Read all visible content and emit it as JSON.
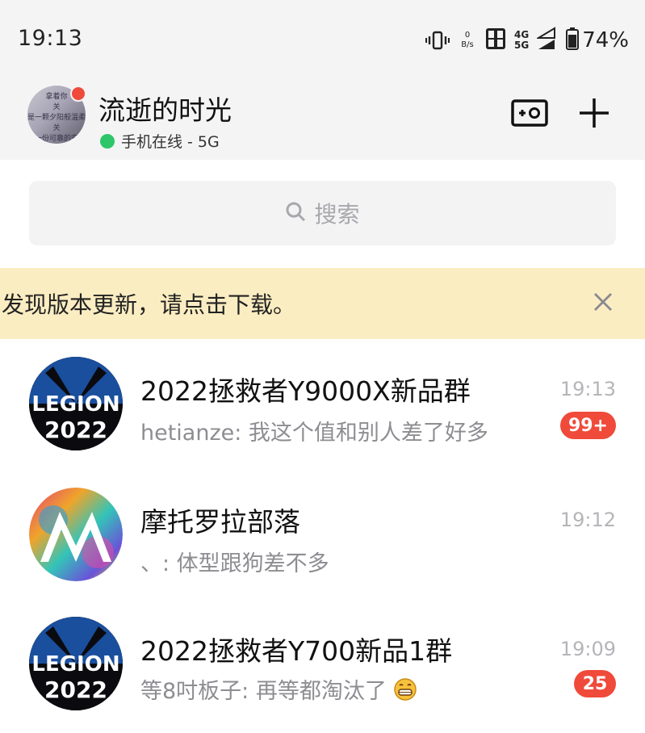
{
  "status_bar": {
    "time": "19:13",
    "net_speed_value": "0",
    "net_speed_unit": "B/s",
    "network_top": "4G",
    "network_bottom": "5G",
    "battery_percent": "74%"
  },
  "header": {
    "nickname": "流逝的时光",
    "online_status": "手机在线 - 5G",
    "avatar_lines": [
      "拿着你",
      "关",
      "是一颗夕阳般温柔",
      "关",
      "是一份可靠的安全"
    ]
  },
  "search": {
    "placeholder": "搜索"
  },
  "banner": {
    "text": "发现版本更新，请点击下载。"
  },
  "chats": [
    {
      "name": "2022拯救者Y9000X新品群",
      "message": "hetianze: 我这个值和别人差了好多",
      "time": "19:13",
      "badge": "99+",
      "avatar_line1": "LEGION",
      "avatar_line2": "2022"
    },
    {
      "name": "摩托罗拉部落",
      "message": "、: 体型跟狗差不多",
      "time": "19:12",
      "badge": ""
    },
    {
      "name": "2022拯救者Y700新品1群",
      "message": "等8吋板子: 再等都淘汰了",
      "time": "19:09",
      "badge": "25",
      "avatar_line1": "LEGION",
      "avatar_line2": "2022"
    }
  ],
  "colors": {
    "accent_red": "#f04a3a",
    "online_green": "#2dc66a",
    "banner_bg": "#fbedc2"
  },
  "icons": {
    "camera": "camera-icon",
    "add": "plus-icon",
    "search": "search-icon",
    "close": "close-icon",
    "emoji": "grin-emoji-icon"
  }
}
